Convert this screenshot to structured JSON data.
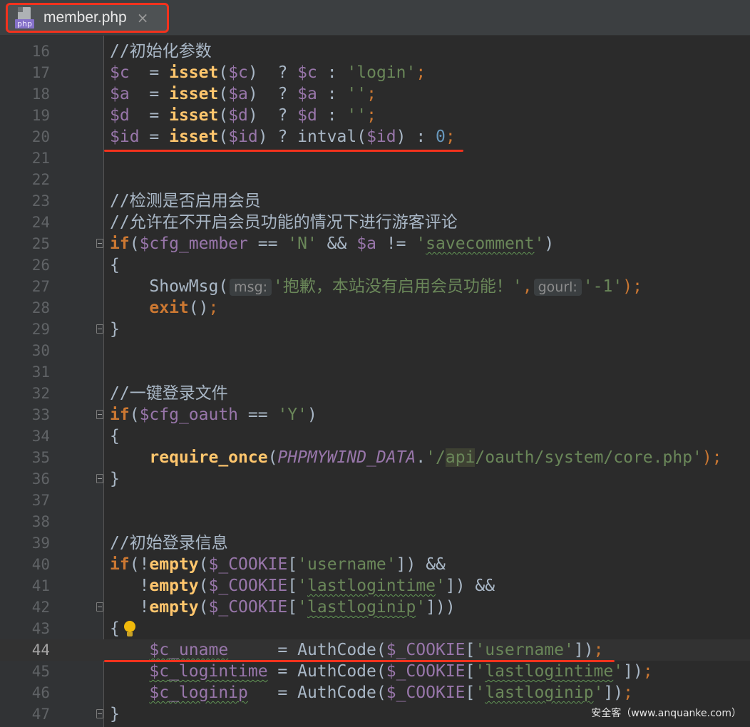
{
  "tab": {
    "file_type_badge": "php",
    "title": "member.php",
    "close_glyph": "×",
    "icon": "php-file-icon"
  },
  "editor": {
    "current_line": 44,
    "lines": [
      {
        "n": 16,
        "tokens": [
          {
            "t": "//初始化参数",
            "c": "comment"
          }
        ]
      },
      {
        "n": 17,
        "tokens": [
          {
            "t": "$c",
            "c": "var"
          },
          {
            "t": "  = ",
            "c": "op"
          },
          {
            "t": "isset",
            "c": "fn-builtin"
          },
          {
            "t": "(",
            "c": "op"
          },
          {
            "t": "$c",
            "c": "var"
          },
          {
            "t": ")  ? ",
            "c": "op"
          },
          {
            "t": "$c",
            "c": "var"
          },
          {
            "t": " : ",
            "c": "op"
          },
          {
            "t": "'login'",
            "c": "str"
          },
          {
            "t": ";",
            "c": "punc"
          }
        ]
      },
      {
        "n": 18,
        "tokens": [
          {
            "t": "$a",
            "c": "var"
          },
          {
            "t": "  = ",
            "c": "op"
          },
          {
            "t": "isset",
            "c": "fn-builtin"
          },
          {
            "t": "(",
            "c": "op"
          },
          {
            "t": "$a",
            "c": "var"
          },
          {
            "t": ")  ? ",
            "c": "op"
          },
          {
            "t": "$a",
            "c": "var"
          },
          {
            "t": " : ",
            "c": "op"
          },
          {
            "t": "''",
            "c": "str"
          },
          {
            "t": ";",
            "c": "punc"
          }
        ]
      },
      {
        "n": 19,
        "tokens": [
          {
            "t": "$d",
            "c": "var"
          },
          {
            "t": "  = ",
            "c": "op"
          },
          {
            "t": "isset",
            "c": "fn-builtin"
          },
          {
            "t": "(",
            "c": "op"
          },
          {
            "t": "$d",
            "c": "var"
          },
          {
            "t": ")  ? ",
            "c": "op"
          },
          {
            "t": "$d",
            "c": "var"
          },
          {
            "t": " : ",
            "c": "op"
          },
          {
            "t": "''",
            "c": "str"
          },
          {
            "t": ";",
            "c": "punc"
          }
        ]
      },
      {
        "n": 20,
        "tokens": [
          {
            "t": "$id",
            "c": "var"
          },
          {
            "t": " = ",
            "c": "op"
          },
          {
            "t": "isset",
            "c": "fn-builtin"
          },
          {
            "t": "(",
            "c": "op"
          },
          {
            "t": "$id",
            "c": "var"
          },
          {
            "t": ") ? intval(",
            "c": "op"
          },
          {
            "t": "$id",
            "c": "var"
          },
          {
            "t": ") : ",
            "c": "op"
          },
          {
            "t": "0",
            "c": "num"
          },
          {
            "t": ";",
            "c": "punc"
          }
        ]
      },
      {
        "n": 21,
        "tokens": []
      },
      {
        "n": 22,
        "tokens": []
      },
      {
        "n": 23,
        "tokens": [
          {
            "t": "//检测是否启用会员",
            "c": "comment"
          }
        ]
      },
      {
        "n": 24,
        "tokens": [
          {
            "t": "//允许在不开启会员功能的情况下进行游客评论",
            "c": "comment"
          }
        ]
      },
      {
        "n": 25,
        "fold": true,
        "tokens": [
          {
            "t": "if",
            "c": "kw"
          },
          {
            "t": "(",
            "c": "op"
          },
          {
            "t": "$cfg_member",
            "c": "var"
          },
          {
            "t": " == ",
            "c": "op"
          },
          {
            "t": "'N'",
            "c": "str"
          },
          {
            "t": " && ",
            "c": "op"
          },
          {
            "t": "$a",
            "c": "var"
          },
          {
            "t": " != ",
            "c": "op"
          },
          {
            "t": "'",
            "c": "str"
          },
          {
            "t": "savecomment",
            "c": "str",
            "squiggle": true
          },
          {
            "t": "'",
            "c": "str"
          },
          {
            "t": ")",
            "c": "op"
          }
        ]
      },
      {
        "n": 26,
        "tokens": [
          {
            "t": "{",
            "c": "op"
          }
        ]
      },
      {
        "n": 27,
        "tokens": [
          {
            "t": "    ShowMsg(",
            "c": "plain"
          },
          {
            "t": "msg:",
            "c": "hint"
          },
          {
            "t": "'抱歉，本站没有启用会员功能！'",
            "c": "str"
          },
          {
            "t": ",",
            "c": "punc"
          },
          {
            "t": "gourl:",
            "c": "hint"
          },
          {
            "t": "'-1'",
            "c": "str"
          },
          {
            "t": ");",
            "c": "punc"
          }
        ]
      },
      {
        "n": 28,
        "tokens": [
          {
            "t": "    ",
            "c": "op"
          },
          {
            "t": "exit",
            "c": "kw"
          },
          {
            "t": "()",
            "c": "op"
          },
          {
            "t": ";",
            "c": "punc"
          }
        ]
      },
      {
        "n": 29,
        "fold": true,
        "tokens": [
          {
            "t": "}",
            "c": "op"
          }
        ]
      },
      {
        "n": 30,
        "tokens": []
      },
      {
        "n": 31,
        "tokens": []
      },
      {
        "n": 32,
        "tokens": [
          {
            "t": "//一键登录文件",
            "c": "comment"
          }
        ]
      },
      {
        "n": 33,
        "fold": true,
        "tokens": [
          {
            "t": "if",
            "c": "kw"
          },
          {
            "t": "(",
            "c": "op"
          },
          {
            "t": "$cfg_oauth",
            "c": "var"
          },
          {
            "t": " == ",
            "c": "op"
          },
          {
            "t": "'Y'",
            "c": "str"
          },
          {
            "t": ")",
            "c": "op"
          }
        ]
      },
      {
        "n": 34,
        "tokens": [
          {
            "t": "{",
            "c": "op"
          }
        ]
      },
      {
        "n": 35,
        "tokens": [
          {
            "t": "    ",
            "c": "op"
          },
          {
            "t": "require_once",
            "c": "fn-builtin"
          },
          {
            "t": "(",
            "c": "op"
          },
          {
            "t": "PHPMYWIND_DATA",
            "c": "const"
          },
          {
            "t": ".",
            "c": "op"
          },
          {
            "t": "'/",
            "c": "str"
          },
          {
            "t": "api",
            "c": "str-hl"
          },
          {
            "t": "/oauth/system/core.php'",
            "c": "str"
          },
          {
            "t": ");",
            "c": "punc"
          }
        ]
      },
      {
        "n": 36,
        "fold": true,
        "tokens": [
          {
            "t": "}",
            "c": "op"
          }
        ]
      },
      {
        "n": 37,
        "tokens": []
      },
      {
        "n": 38,
        "tokens": []
      },
      {
        "n": 39,
        "tokens": [
          {
            "t": "//初始登录信息",
            "c": "comment"
          }
        ]
      },
      {
        "n": 40,
        "tokens": [
          {
            "t": "if",
            "c": "kw"
          },
          {
            "t": "(!",
            "c": "op"
          },
          {
            "t": "empty",
            "c": "fn-builtin"
          },
          {
            "t": "(",
            "c": "op"
          },
          {
            "t": "$_COOKIE",
            "c": "var"
          },
          {
            "t": "[",
            "c": "op"
          },
          {
            "t": "'username'",
            "c": "str"
          },
          {
            "t": "]) ",
            "c": "op"
          },
          {
            "t": "&&",
            "c": "op"
          }
        ]
      },
      {
        "n": 41,
        "tokens": [
          {
            "t": "   !",
            "c": "op"
          },
          {
            "t": "empty",
            "c": "fn-builtin"
          },
          {
            "t": "(",
            "c": "op"
          },
          {
            "t": "$_COOKIE",
            "c": "var"
          },
          {
            "t": "[",
            "c": "op"
          },
          {
            "t": "'",
            "c": "str"
          },
          {
            "t": "lastlogintime",
            "c": "str",
            "squiggle": true
          },
          {
            "t": "'",
            "c": "str"
          },
          {
            "t": "]) ",
            "c": "op"
          },
          {
            "t": "&&",
            "c": "op"
          }
        ]
      },
      {
        "n": 42,
        "fold": true,
        "tokens": [
          {
            "t": "   !",
            "c": "op"
          },
          {
            "t": "empty",
            "c": "fn-builtin"
          },
          {
            "t": "(",
            "c": "op"
          },
          {
            "t": "$_COOKIE",
            "c": "var"
          },
          {
            "t": "[",
            "c": "op"
          },
          {
            "t": "'",
            "c": "str"
          },
          {
            "t": "lastloginip",
            "c": "str",
            "squiggle": true
          },
          {
            "t": "'",
            "c": "str"
          },
          {
            "t": "]))",
            "c": "op"
          }
        ]
      },
      {
        "n": 43,
        "bulb": true,
        "tokens": [
          {
            "t": "{",
            "c": "op"
          }
        ]
      },
      {
        "n": 44,
        "tokens": [
          {
            "t": "    ",
            "c": "op"
          },
          {
            "t": "$c_uname",
            "c": "var",
            "squiggle": true
          },
          {
            "t": "     = AuthCode(",
            "c": "plain"
          },
          {
            "t": "$_COOKIE",
            "c": "var"
          },
          {
            "t": "[",
            "c": "op"
          },
          {
            "t": "'username'",
            "c": "str"
          },
          {
            "t": "])",
            "c": "op"
          },
          {
            "t": ";",
            "c": "punc"
          }
        ]
      },
      {
        "n": 45,
        "tokens": [
          {
            "t": "    ",
            "c": "op"
          },
          {
            "t": "$c_logintime",
            "c": "var",
            "squiggle": true
          },
          {
            "t": " = AuthCode(",
            "c": "plain"
          },
          {
            "t": "$_COOKIE",
            "c": "var"
          },
          {
            "t": "[",
            "c": "op"
          },
          {
            "t": "'",
            "c": "str"
          },
          {
            "t": "lastlogintime",
            "c": "str",
            "squiggle": true
          },
          {
            "t": "'",
            "c": "str"
          },
          {
            "t": "])",
            "c": "op"
          },
          {
            "t": ";",
            "c": "punc"
          }
        ]
      },
      {
        "n": 46,
        "tokens": [
          {
            "t": "    ",
            "c": "op"
          },
          {
            "t": "$c_loginip",
            "c": "var",
            "squiggle": true
          },
          {
            "t": "   = AuthCode(",
            "c": "plain"
          },
          {
            "t": "$_COOKIE",
            "c": "var"
          },
          {
            "t": "[",
            "c": "op"
          },
          {
            "t": "'",
            "c": "str"
          },
          {
            "t": "lastloginip",
            "c": "str",
            "squiggle": true
          },
          {
            "t": "'",
            "c": "str"
          },
          {
            "t": "])",
            "c": "op"
          },
          {
            "t": ";",
            "c": "punc"
          }
        ]
      },
      {
        "n": 47,
        "fold": true,
        "tokens": [
          {
            "t": "}",
            "c": "op"
          }
        ]
      }
    ]
  },
  "annotation_color": "#f3321d",
  "watermark": "安全客（www.anquanke.com）"
}
